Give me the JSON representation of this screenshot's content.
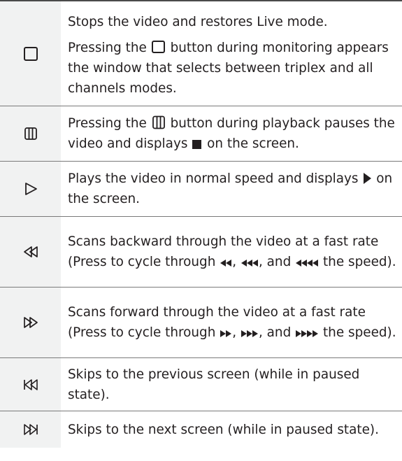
{
  "rows": [
    {
      "icon": "stop-icon",
      "lines": [
        "Stops the video and restores Live mode.",
        "Pressing the",
        "button during monitoring appears the window that selects between triplex and all channels modes."
      ]
    },
    {
      "icon": "pause-icon",
      "p_pre": "Pressing the",
      "p_mid": "button during playback pauses the video and displays",
      "p_post": "on the screen."
    },
    {
      "icon": "play-icon",
      "text_pre": "Plays the video in normal speed and displays",
      "text_post": "on the screen."
    },
    {
      "icon": "rewind-icon",
      "t1": "Scans backward through the video at a fast rate (Press to cycle through",
      "t2": ",",
      "t3": ", and",
      "t4": "the speed)."
    },
    {
      "icon": "fast-forward-icon",
      "t1": "Scans forward through the video at a fast rate (Press to cycle through",
      "t2": ",",
      "t3": ", and",
      "t4": "the speed)."
    },
    {
      "icon": "previous-frame-icon",
      "text": "Skips to the previous screen (while in paused state)."
    },
    {
      "icon": "next-frame-icon",
      "text": "Skips to the next screen (while in paused state)."
    }
  ]
}
